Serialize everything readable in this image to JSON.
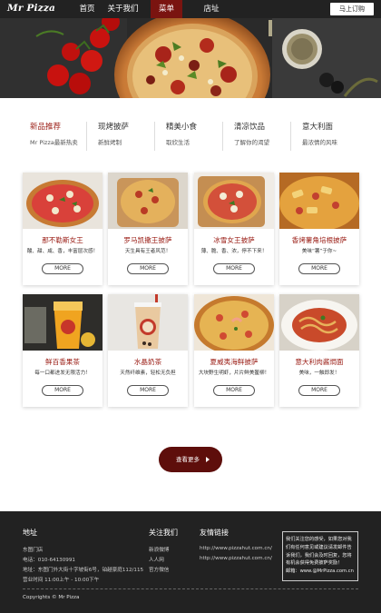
{
  "brand": {
    "name": "Mr Pizza"
  },
  "nav": {
    "items": [
      {
        "label": "首页"
      },
      {
        "label": "关于我们"
      },
      {
        "label": "菜单"
      },
      {
        "label": "店址"
      }
    ],
    "active": "菜单",
    "order_button": "马上订购"
  },
  "categories": [
    {
      "title": "新品推荐",
      "subtitle": "Mr Pizza最新热卖"
    },
    {
      "title": "现烤披萨",
      "subtitle": "新鲜烤制"
    },
    {
      "title": "精美小食",
      "subtitle": "取欣生活"
    },
    {
      "title": "清凉饮品",
      "subtitle": "了解你的渴望"
    },
    {
      "title": "意大利面",
      "subtitle": "最浓情的风味"
    }
  ],
  "products": [
    {
      "name": "那不勒斯女王",
      "desc": "酸、甜、咸、香，丰富层次感！",
      "button": "MORE"
    },
    {
      "name": "罗马凯撒王披萨",
      "desc": "天生具有王者风范！",
      "button": "MORE"
    },
    {
      "name": "冰雪女王披萨",
      "desc": "薄、脆、香、浓，停不下来！",
      "button": "MORE"
    },
    {
      "name": "香烤薯角培根披萨",
      "desc": "美味“薯”于你~",
      "button": "MORE"
    },
    {
      "name": "鲜百香果茶",
      "desc": "每一口都进发无限活力！",
      "button": "MORE"
    },
    {
      "name": "水晶奶茶",
      "desc": "天然纤维素，轻松无负担",
      "button": "MORE"
    },
    {
      "name": "夏威夷海鲜披萨",
      "desc": "大块野生明虾，片片鲜美鳌柳！",
      "button": "MORE"
    },
    {
      "name": "意大利肉酱焗面",
      "desc": "美味，一触即发！",
      "button": "MORE"
    }
  ],
  "more_button": "查看更多",
  "footer": {
    "address": {
      "heading": "地址",
      "lines": [
        "东图门店",
        "电话：010-64130991",
        "地址：东图门外大街十字坡街6号，铂越豪庭112/115",
        "营业时间 11:00上午 - 10:00下午"
      ]
    },
    "follow": {
      "heading": "关注我们",
      "lines": [
        "新浪微博",
        "人人网",
        "官方微信"
      ]
    },
    "links": {
      "heading": "友情链接",
      "lines": [
        "http://www.pizzahut.com.cn/",
        "http://www.pizzahut.com.cn/"
      ]
    },
    "notice": [
      "我们关注您的感受，如果您对我",
      "们有任何意见或建议请发邮件告",
      "诉我们，我们会及时回复，您将",
      "有机会获得免费披萨奖励！",
      "邮箱：www.@MrPizza.com.cn"
    ],
    "copyright": "Copyrights © Mr Pizza"
  },
  "colors": {
    "accent": "#9a1c14",
    "nav_bg": "#222222",
    "nav_active": "#7a1410",
    "footer_bg": "#222222",
    "button_dark": "#5e0e0b"
  }
}
